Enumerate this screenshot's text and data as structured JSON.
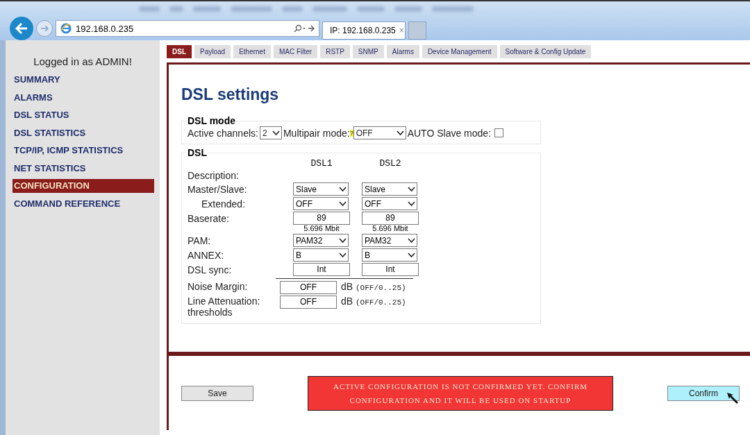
{
  "browser": {
    "url": "192.168.0.235",
    "tab_title": "IP: 192.168.0.235",
    "tab_close": "×"
  },
  "sidebar": {
    "login_text": "Logged in as ADMIN!",
    "items": [
      {
        "label": "SUMMARY",
        "selected": false
      },
      {
        "label": "ALARMS",
        "selected": false
      },
      {
        "label": "DSL STATUS",
        "selected": false
      },
      {
        "label": "DSL STATISTICS",
        "selected": false
      },
      {
        "label": "TCP/IP, ICMP STATISTICS",
        "selected": false
      },
      {
        "label": "NET STATISTICS",
        "selected": false
      },
      {
        "label": "CONFIGURATION",
        "selected": true
      },
      {
        "label": "COMMAND REFERENCE",
        "selected": false
      }
    ]
  },
  "tabs": [
    {
      "label": "DSL",
      "selected": true
    },
    {
      "label": "Payload",
      "selected": false
    },
    {
      "label": "Ethernet",
      "selected": false
    },
    {
      "label": "MAC Filter",
      "selected": false
    },
    {
      "label": "RSTP",
      "selected": false
    },
    {
      "label": "SNMP",
      "selected": false
    },
    {
      "label": "Alarms",
      "selected": false
    },
    {
      "label": "Device Management",
      "selected": false
    },
    {
      "label": "Software & Config Update",
      "selected": false
    }
  ],
  "page_title": "DSL settings",
  "dsl_mode": {
    "legend": "DSL mode",
    "active_channels": {
      "label": "Active channels:",
      "value": "2"
    },
    "multipair": {
      "label": "Multipair mode:",
      "help": "?",
      "value": "OFF"
    },
    "auto_slave": {
      "label": "AUTO Slave mode:",
      "checked": false
    }
  },
  "dsl": {
    "legend": "DSL",
    "columns": [
      "DSL1",
      "DSL2"
    ],
    "rows": [
      {
        "kind": "text",
        "label": "Description:"
      },
      {
        "kind": "select",
        "label": "Master/Slave:",
        "values": [
          "Slave",
          "Slave"
        ]
      },
      {
        "kind": "subselect",
        "label": "Extended:",
        "values": [
          "OFF",
          "OFF"
        ]
      },
      {
        "kind": "input",
        "label": "Baserate:",
        "values": [
          "89",
          "89"
        ],
        "notes": [
          "5.696 Mbit",
          "5.696 Mbit"
        ]
      },
      {
        "kind": "select",
        "label": "PAM:",
        "values": [
          "PAM32",
          "PAM32"
        ]
      },
      {
        "kind": "select",
        "label": "ANNEX:",
        "values": [
          "B",
          "B"
        ]
      },
      {
        "kind": "input",
        "label": "DSL sync:",
        "values": [
          "Int",
          "Int"
        ]
      }
    ],
    "thresholds": [
      {
        "label": "Noise Margin:",
        "value": "OFF",
        "unit": "dB",
        "range": "(OFF/0..25)"
      },
      {
        "label": "Line Attenuation:",
        "sublabel": "thresholds",
        "value": "OFF",
        "unit": "dB",
        "range": "(OFF/0..25)"
      }
    ]
  },
  "footer": {
    "save": "Save",
    "warning": "ACTIVE CONFIGURATION IS NOT CONFIRMED YET. CONFIRM CONFIGURATION AND IT WILL BE USED ON STARTUP",
    "confirm": "Confirm"
  }
}
